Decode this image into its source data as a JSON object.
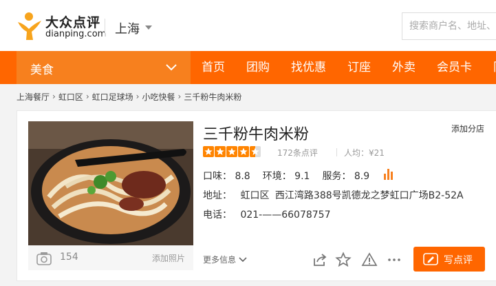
{
  "header": {
    "logo_cn": "大众点评",
    "logo_en": "dianping.com",
    "city": "上海",
    "search_placeholder": "搜索商户名、地址、"
  },
  "nav": {
    "category": "美食",
    "items": [
      "首页",
      "团购",
      "找优惠",
      "订座",
      "外卖",
      "会员卡",
      "同城"
    ]
  },
  "breadcrumb": [
    "上海餐厅",
    "虹口区",
    "虹口足球场",
    "小吃快餐",
    "三千粉牛肉米粉"
  ],
  "shop": {
    "name": "三千粉牛肉米粉",
    "add_branch": "添加分店",
    "rating_stars": 4.5,
    "reviews": "172条点评",
    "avg_price": "人均：¥21",
    "scores": [
      "口味： 8.8",
      "环境： 9.1",
      "服务： 8.9"
    ],
    "address_label": "地址：",
    "district": "虹口区",
    "address": "西江湾路388号凯德龙之梦虹口广场B2-52A",
    "phone_label": "电话：",
    "phone": "021-——66078757",
    "photo_count": "154",
    "add_photo": "添加照片",
    "more_info": "更多信息",
    "write_review": "写点评"
  },
  "colors": {
    "brand_orange": "#ff6600",
    "nav_category": "#f7801e",
    "star": "#ff8400"
  },
  "icons": [
    "logo-mark-icon",
    "caret-down-icon",
    "chevron-down-icon",
    "camera-icon",
    "bar-chart-icon",
    "share-icon",
    "star-outline-icon",
    "warning-icon",
    "more-icon",
    "pen-icon"
  ]
}
